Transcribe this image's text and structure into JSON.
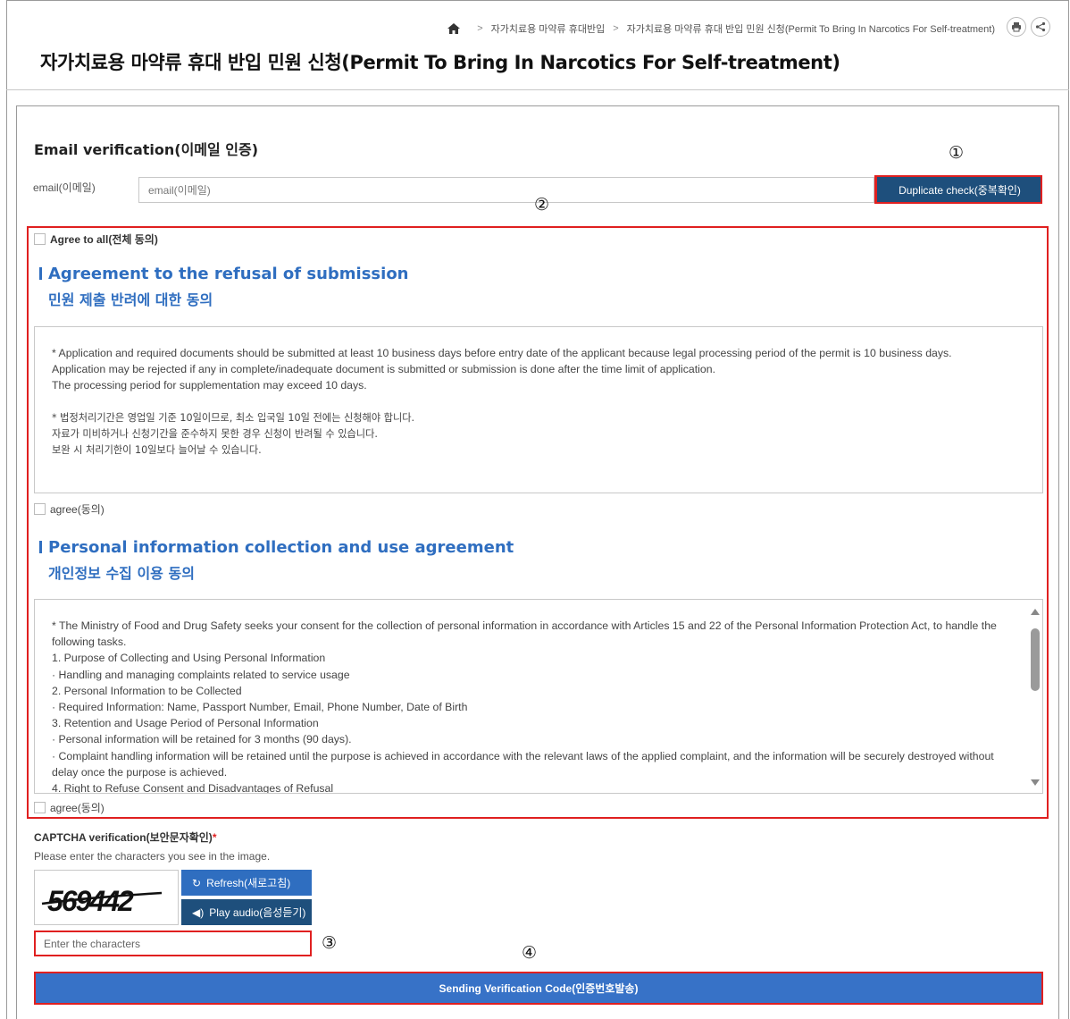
{
  "breadcrumb": {
    "items": [
      "자가치료용 마약류 휴대반입",
      "자가치료용 마약류 휴대 반입 민원 신청(Permit To Bring In Narcotics For Self-treatment)"
    ]
  },
  "page": {
    "title": "자가치료용 마약류 휴대 반입 민원 신청(Permit To Bring In Narcotics For Self-treatment)"
  },
  "email_section": {
    "heading": "Email verification(이메일 인증)",
    "label": "email(이메일)",
    "placeholder": "email(이메일)",
    "duplicate_button": "Duplicate check(중복확인)"
  },
  "markers": [
    "①",
    "②",
    "③",
    "④"
  ],
  "agreements": {
    "agree_all": "Agree to all(전체 동의)",
    "refusal": {
      "title": "Agreement to the refusal of submission",
      "subtitle": "민원 제출 반려에 대한 동의",
      "lines": [
        "* Application and required documents should be submitted at least 10 business days before entry date of the applicant because legal processing period of the permit is 10 business days.",
        "Application may be rejected if any in complete/inadequate document is submitted or submission is done after the time limit of application.",
        "The processing period for supplementation may exceed 10 days."
      ],
      "lines_ko": [
        "* 법정처리기간은 영업일 기준 10일이므로, 최소 입국일 10일 전에는 신청해야 합니다.",
        "자료가 미비하거나 신청기간을 준수하지 못한 경우 신청이 반려될 수 있습니다.",
        "보완 시 처리기한이 10일보다 늘어날 수 있습니다."
      ],
      "agree_label": "agree(동의)"
    },
    "privacy": {
      "title": "Personal information collection and use agreement",
      "subtitle": "개인정보 수집 이용 동의",
      "lines": [
        "* The Ministry of Food and Drug Safety seeks your consent for the collection of personal information in accordance with Articles 15 and 22 of the Personal Information Protection Act, to handle the following tasks.",
        "1. Purpose of Collecting and Using Personal Information",
        "· Handling and managing complaints related to service usage",
        "2. Personal Information to be Collected",
        "· Required Information: Name, Passport Number, Email, Phone Number, Date of Birth",
        "3. Retention and Usage Period of Personal Information",
        "· Personal information will be retained for 3 months (90 days).",
        "· Complaint handling information will be retained until the purpose is achieved in accordance with the relevant laws of the applied complaint, and the information will be securely destroyed without delay once the purpose is achieved.",
        "4. Right to Refuse Consent and Disadvantages of Refusal"
      ],
      "agree_label": "agree(동의)"
    }
  },
  "captcha": {
    "heading": "CAPTCHA verification(보안문자확인)",
    "required_mark": "*",
    "description": "Please enter the characters you see in the image.",
    "image_text": "569442",
    "refresh_button": "Refresh(새로고침)",
    "audio_button": "Play audio(음성듣기)",
    "input_placeholder": "Enter the characters"
  },
  "send_button": "Sending Verification Code(인증번호발송)",
  "colors": {
    "accent_blue": "#2f6ec0",
    "dark_blue": "#1e4f7c",
    "highlight_red": "#e02020"
  }
}
